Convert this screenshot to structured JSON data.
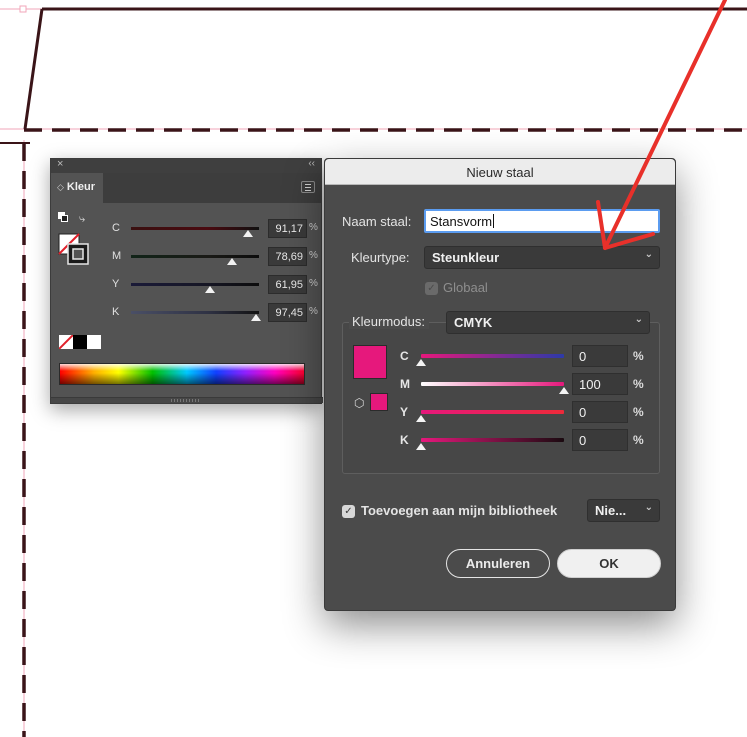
{
  "colors": {
    "guide_pink": "#f2a6b8",
    "frame_dark": "#3a1418",
    "annotation_red": "#e8302a",
    "magenta": "#e6187c"
  },
  "kleur_panel": {
    "close_icon": "close-icon",
    "collapse_icon": "collapse-icon",
    "tab_label": "Kleur",
    "menu_icon": "panel-menu-icon",
    "channels": [
      {
        "label": "C",
        "value": "91,17",
        "unit": "%",
        "level": 0.9117
      },
      {
        "label": "M",
        "value": "78,69",
        "unit": "%",
        "level": 0.7869
      },
      {
        "label": "Y",
        "value": "61,95",
        "unit": "%",
        "level": 0.6195
      },
      {
        "label": "K",
        "value": "97,45",
        "unit": "%",
        "level": 0.9745
      }
    ]
  },
  "dialog": {
    "title": "Nieuw staal",
    "naam_label": "Naam staal:",
    "naam_value": "Stansvorm",
    "kleurtype_label": "Kleurtype:",
    "kleurtype_value": "Steunkleur",
    "globaal_label": "Globaal",
    "globaal_checked": true,
    "kleurmodus_label": "Kleurmodus:",
    "kleurmodus_value": "CMYK",
    "swatch_color": "#e6187c",
    "channels": [
      {
        "label": "C",
        "value": "0",
        "unit": "%",
        "level": 0.0
      },
      {
        "label": "M",
        "value": "100",
        "unit": "%",
        "level": 1.0
      },
      {
        "label": "Y",
        "value": "0",
        "unit": "%",
        "level": 0.0
      },
      {
        "label": "K",
        "value": "0",
        "unit": "%",
        "level": 0.0
      }
    ],
    "library_label": "Toevoegen aan mijn bibliotheek",
    "library_checked": true,
    "library_select": "Nie...",
    "cancel_label": "Annuleren",
    "ok_label": "OK"
  }
}
